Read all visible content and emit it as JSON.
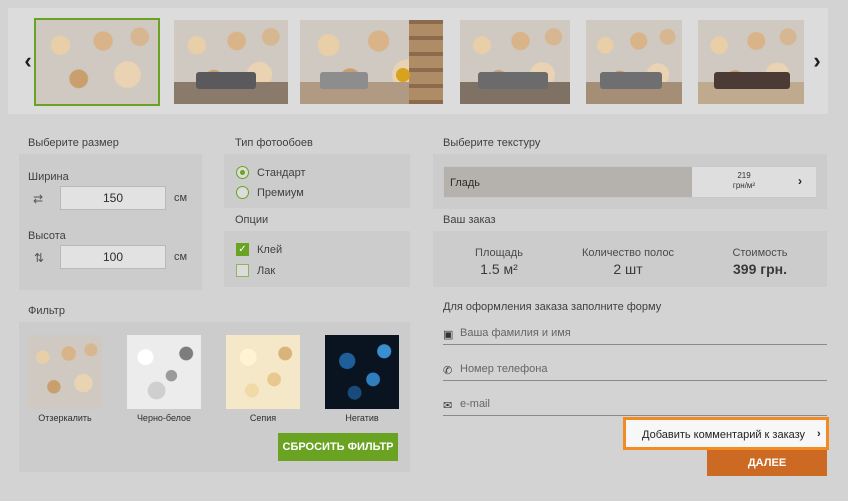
{
  "carousel": {
    "prev_icon": "chevron-left-icon",
    "next_icon": "chevron-right-icon",
    "prev_glyph": "‹",
    "next_glyph": "›",
    "selected_index": 0
  },
  "size": {
    "title": "Выберите размер",
    "width_label": "Ширина",
    "width_value": "150",
    "height_label": "Высота",
    "height_value": "100",
    "unit": "см",
    "width_icon": "⇄",
    "height_icon": "⇅"
  },
  "type": {
    "title": "Тип фотообоев",
    "options": [
      "Стандарт",
      "Премиум"
    ],
    "selected": "Стандарт"
  },
  "options": {
    "title": "Опции",
    "items": [
      {
        "label": "Клей",
        "checked": true
      },
      {
        "label": "Лак",
        "checked": false
      }
    ],
    "check_glyph": "✓"
  },
  "texture": {
    "title": "Выберите текстуру",
    "name": "Гладь",
    "price_line1": "219",
    "price_line2": "грн/м²",
    "chevron": "›"
  },
  "order": {
    "title": "Ваш заказ",
    "area_label": "Площадь",
    "area_value": "1.5 м²",
    "strips_label": "Количество полос",
    "strips_value": "2 шт",
    "cost_label": "Стоимость",
    "cost_value": "399 грн."
  },
  "filter": {
    "title": "Фильтр",
    "items": [
      "Отзеркалить",
      "Черно-белое",
      "Сепия",
      "Негатив"
    ],
    "reset_label": "СБРОСИТЬ ФИЛЬТР"
  },
  "form": {
    "title": "Для оформления заказа заполните форму",
    "name_placeholder": "Ваша фамилия и имя",
    "phone_placeholder": "Номер телефона",
    "email_placeholder": "e-mail",
    "name_icon_glyph": "▣",
    "phone_icon_glyph": "✆",
    "email_icon_glyph": "✉",
    "comment_label": "Добавить комментарий к заказу",
    "comment_chevron": "›",
    "next_label": "ДАЛЕЕ"
  },
  "colors": {
    "accent_green": "#6aa321",
    "accent_orange": "#cc6a24",
    "highlight_orange": "#f28b21"
  }
}
